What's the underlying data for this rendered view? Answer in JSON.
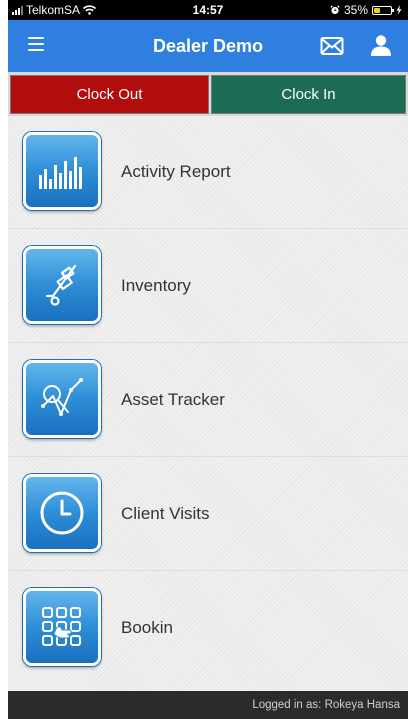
{
  "status_bar": {
    "carrier": "TelkomSA",
    "time": "14:57",
    "battery_percent_text": "35%",
    "battery_level": 0.35,
    "icons": [
      "signal-icon",
      "wifi-icon",
      "alarm-icon",
      "battery-icon",
      "charging-bolt-icon"
    ]
  },
  "nav": {
    "title": "Dealer Demo",
    "icons": [
      "hamburger-menu-icon",
      "mail-icon",
      "user-icon"
    ]
  },
  "clock": {
    "clock_out_label": "Clock Out",
    "clock_in_label": "Clock In"
  },
  "menu": {
    "items": [
      {
        "label": "Activity Report",
        "icon": "bar-chart-icon"
      },
      {
        "label": "Inventory",
        "icon": "hand-truck-icon"
      },
      {
        "label": "Asset Tracker",
        "icon": "magnifier-graph-icon"
      },
      {
        "label": "Client Visits",
        "icon": "clock-icon"
      },
      {
        "label": "Bookin",
        "icon": "grid-touch-icon"
      }
    ]
  },
  "footer": {
    "logged_in_text": "Logged in as: Rokeya Hansa"
  },
  "colors": {
    "nav_blue": "#2f7fe0",
    "clock_out_red": "#b10d0d",
    "clock_in_green": "#1c6b55",
    "tile_blue": "#2d8ed6",
    "footer_dark": "#2b2b2b"
  }
}
